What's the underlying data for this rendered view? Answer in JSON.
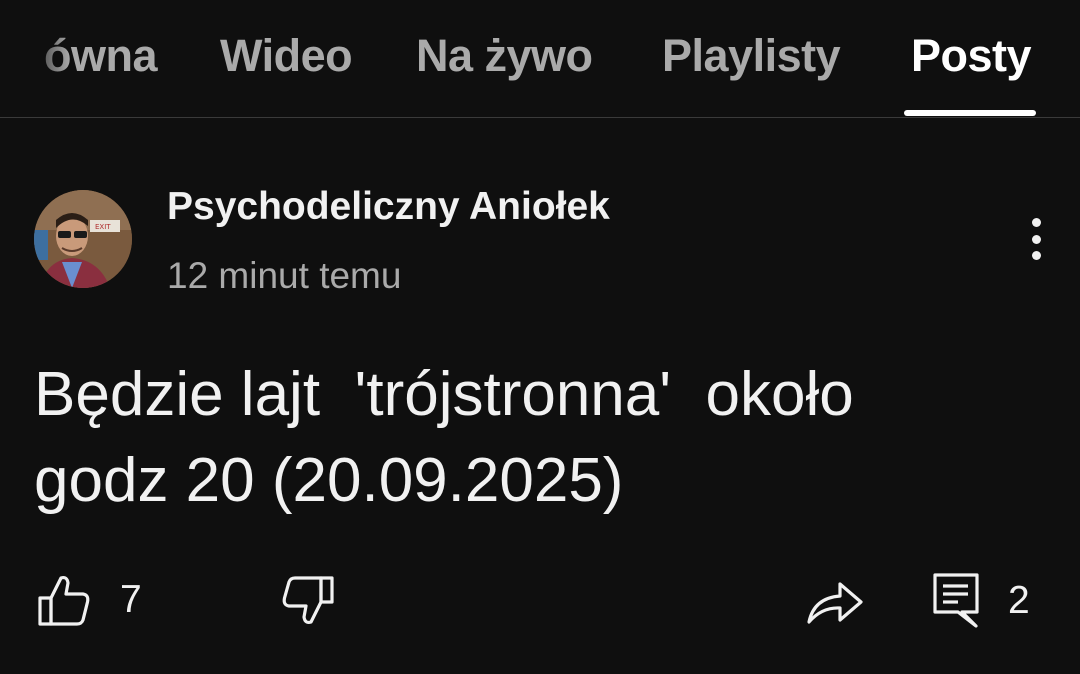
{
  "tabs": [
    {
      "label": "ówna",
      "active": false
    },
    {
      "label": "Wideo",
      "active": false
    },
    {
      "label": "Na żywo",
      "active": false
    },
    {
      "label": "Playlisty",
      "active": false
    },
    {
      "label": "Posty",
      "active": true
    }
  ],
  "post": {
    "author": "Psychodeliczny Aniołek",
    "timestamp": "12 minut temu",
    "text_line1": "Będzie lajt  'trójstronna'  około",
    "text_line2": "godz 20 (20.09.2025)",
    "likes": "7",
    "comments": "2",
    "avatar_sign_text": "EXIT"
  },
  "icons": {
    "more": "more-vertical-icon",
    "like": "thumb-up-icon",
    "dislike": "thumb-down-icon",
    "share": "share-arrow-icon",
    "comments": "comment-icon"
  },
  "colors": {
    "background": "#0f0f0f",
    "text_primary": "#f1f1f1",
    "text_secondary": "#aaaaaa",
    "divider": "#3a3a3a",
    "tab_indicator": "#ffffff"
  }
}
